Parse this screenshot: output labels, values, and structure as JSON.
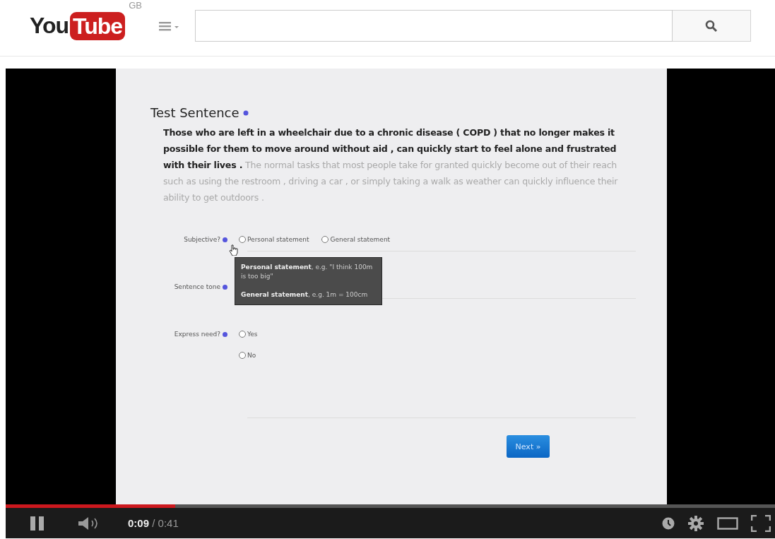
{
  "header": {
    "logo": {
      "word": "You",
      "badge_word": "Tube"
    },
    "region": "GB"
  },
  "video": {
    "page": {
      "title": "Test Sentence",
      "sentence": "**Those who are left in a wheelchair due to a chronic disease ( COPD ) that no longer makes it possible for them to move around without aid , can quickly start to feel alone and frustrated with their lives .** The normal tasks that most people take for granted quickly become out of their reach such as using the restroom , driving a car , or simply taking a walk as weather can quickly influence their ability to get outdoors .",
      "questions": [
        {
          "label": "Subjective?",
          "kind": "inline",
          "options": [
            {
              "label": "Personal statement",
              "selected": false
            },
            {
              "label": "General statement",
              "selected": false
            }
          ]
        },
        {
          "label": "Sentence tone",
          "kind": "inline"
        },
        {
          "label": "Express need?",
          "kind": "stacked",
          "options": [
            {
              "label": "Yes",
              "selected": false
            },
            {
              "label": "No",
              "selected": false
            }
          ]
        }
      ],
      "tooltip": {
        "lines": [
          "**Personal statement**, e.g. \"I think 100m is too big\"",
          "**General statement**, e.g. 1m = 100cm"
        ]
      },
      "next_button": "Next »"
    },
    "player": {
      "playing": true,
      "level": 0.22,
      "current_time": "0:09",
      "duration": "/ 0:41"
    }
  }
}
